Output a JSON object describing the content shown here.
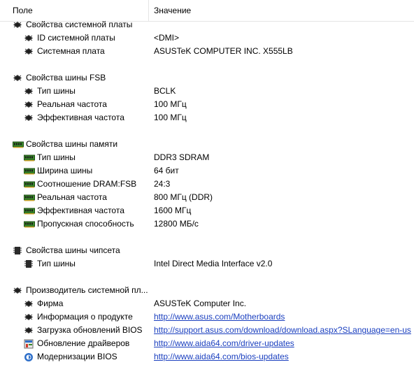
{
  "header": {
    "field_label": "Поле",
    "value_label": "Значение"
  },
  "groups": [
    {
      "title": "Свойства системной платы",
      "icon": "motherboard-chip-icon",
      "items": [
        {
          "name": "ID системной платы",
          "value": "<DMI>",
          "icon": "motherboard-chip-icon"
        },
        {
          "name": "Системная плата",
          "value": "ASUSTeK COMPUTER INC. X555LB",
          "icon": "motherboard-chip-icon"
        }
      ]
    },
    {
      "title": "Свойства шины FSB",
      "icon": "motherboard-chip-icon",
      "items": [
        {
          "name": "Тип шины",
          "value": "BCLK",
          "icon": "motherboard-chip-icon"
        },
        {
          "name": "Реальная частота",
          "value": "100 МГц",
          "icon": "motherboard-chip-icon"
        },
        {
          "name": "Эффективная частота",
          "value": "100 МГц",
          "icon": "motherboard-chip-icon"
        }
      ]
    },
    {
      "title": "Свойства шины памяти",
      "icon": "memory-module-icon",
      "items": [
        {
          "name": "Тип шины",
          "value": "DDR3 SDRAM",
          "icon": "memory-module-icon"
        },
        {
          "name": "Ширина шины",
          "value": "64 бит",
          "icon": "memory-module-icon"
        },
        {
          "name": "Соотношение DRAM:FSB",
          "value": "24:3",
          "icon": "memory-module-icon"
        },
        {
          "name": "Реальная частота",
          "value": "800 МГц (DDR)",
          "icon": "memory-module-icon"
        },
        {
          "name": "Эффективная частота",
          "value": "1600 МГц",
          "icon": "memory-module-icon"
        },
        {
          "name": "Пропускная способность",
          "value": "12800 МБ/с",
          "icon": "memory-module-icon"
        }
      ]
    },
    {
      "title": "Свойства шины чипсета",
      "icon": "chipset-bus-icon",
      "items": [
        {
          "name": "Тип шины",
          "value": "Intel Direct Media Interface v2.0",
          "icon": "chipset-bus-icon"
        }
      ]
    },
    {
      "title": "Производитель системной пл...",
      "icon": "motherboard-chip-icon",
      "items": [
        {
          "name": "Фирма",
          "value": "ASUSTeK Computer Inc.",
          "icon": "motherboard-chip-icon",
          "link": false
        },
        {
          "name": "Информация о продукте",
          "value": "http://www.asus.com/Motherboards",
          "icon": "motherboard-chip-icon",
          "link": true
        },
        {
          "name": "Загрузка обновлений BIOS",
          "value": "http://support.asus.com/download/download.aspx?SLanguage=en-us",
          "icon": "motherboard-chip-icon",
          "link": true
        },
        {
          "name": "Обновление драйверов",
          "value": "http://www.aida64.com/driver-updates",
          "icon": "driver-update-icon",
          "link": true
        },
        {
          "name": "Модернизации BIOS",
          "value": "http://www.aida64.com/bios-updates",
          "icon": "bios-upgrade-icon",
          "link": true
        }
      ]
    }
  ],
  "colors": {
    "link": "#1a3fbf",
    "memory_green": "#3a8a2a",
    "chip_dark": "#2b2b2b"
  }
}
